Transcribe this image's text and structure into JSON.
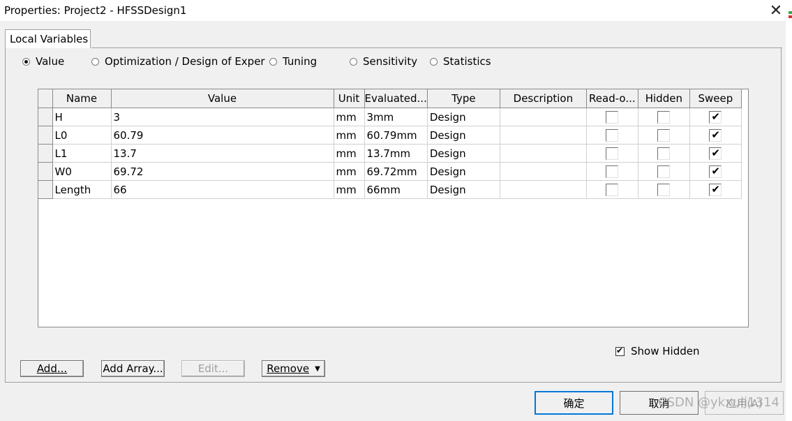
{
  "window": {
    "title": "Properties: Project2 - HFSSDesign1",
    "close_glyph": "✕"
  },
  "tabs": [
    {
      "label": "Local Variables"
    }
  ],
  "radios": [
    {
      "label": "Value",
      "checked": true
    },
    {
      "label": "Optimization / Design of Exper",
      "checked": false
    },
    {
      "label": "Tuning",
      "checked": false
    },
    {
      "label": "Sensitivity",
      "checked": false
    },
    {
      "label": "Statistics",
      "checked": false
    }
  ],
  "table": {
    "columns": [
      "Name",
      "Value",
      "Unit",
      "Evaluated...",
      "Type",
      "Description",
      "Read-o...",
      "Hidden",
      "Sweep"
    ],
    "rows": [
      {
        "name": "H",
        "value": "3",
        "unit": "mm",
        "evaluated": "3mm",
        "type": "Design",
        "description": "",
        "readonly": false,
        "hidden": false,
        "sweep": true
      },
      {
        "name": "L0",
        "value": "60.79",
        "unit": "mm",
        "evaluated": "60.79mm",
        "type": "Design",
        "description": "",
        "readonly": false,
        "hidden": false,
        "sweep": true
      },
      {
        "name": "L1",
        "value": "13.7",
        "unit": "mm",
        "evaluated": "13.7mm",
        "type": "Design",
        "description": "",
        "readonly": false,
        "hidden": false,
        "sweep": true
      },
      {
        "name": "W0",
        "value": "69.72",
        "unit": "mm",
        "evaluated": "69.72mm",
        "type": "Design",
        "description": "",
        "readonly": false,
        "hidden": false,
        "sweep": true
      },
      {
        "name": "Length",
        "value": "66",
        "unit": "mm",
        "evaluated": "66mm",
        "type": "Design",
        "description": "",
        "readonly": false,
        "hidden": false,
        "sweep": true
      }
    ]
  },
  "buttons": {
    "add": "Add...",
    "add_array": "Add Array...",
    "edit": "Edit...",
    "remove": "Remove",
    "remove_arrow": "▼"
  },
  "show_hidden": {
    "label": "Show Hidden",
    "checked": true
  },
  "dialog_buttons": {
    "ok": "确定",
    "cancel": "取消",
    "apply": "应用(A)"
  },
  "watermark": "CSDN @ykxuli1314"
}
